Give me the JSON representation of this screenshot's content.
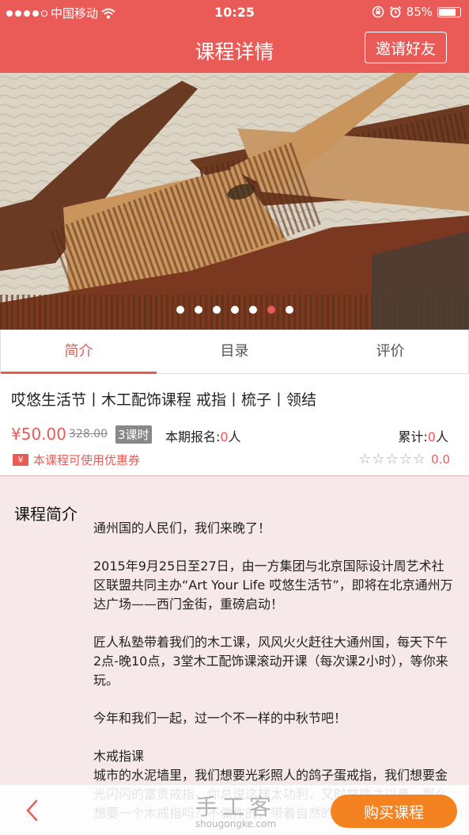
{
  "status": {
    "carrier": "中国移动",
    "time": "10:25",
    "battery_text": "85%",
    "battery_level": 0.85
  },
  "nav": {
    "title": "课程详情",
    "invite_label": "邀请好友"
  },
  "banner": {
    "slide_count": 7,
    "active_index": 5
  },
  "tabs": [
    {
      "label": "简介",
      "active": true
    },
    {
      "label": "目录",
      "active": false
    },
    {
      "label": "评价",
      "active": false
    }
  ],
  "course": {
    "title": "哎悠生活节丨木工配饰课程 戒指丨梳子丨领结",
    "price": "¥50.00",
    "original_price": "328.00",
    "hours": "3课时",
    "enroll_label": "本期报名:",
    "enroll_count": "0",
    "enroll_unit": "人",
    "total_label": "累计:",
    "total_count": "0",
    "total_unit": "人",
    "coupon_icon": "¥",
    "coupon_text": "本课程可使用优惠券",
    "stars": "☆☆☆☆☆",
    "rating": "0.0"
  },
  "intro": {
    "heading": "课程简介",
    "paragraphs": [
      "通州国的人民们，我们来晚了！",
      "2015年9月25日至27日，由一方集团与北京国际设计周艺术社区联盟共同主办“Art Your Life 哎悠生活节”，即将在北京通州万达广场——西门金街，重磅启动！",
      "匠人私塾带着我们的木工课，风风火火赶往大通州国，每天下午2点-晚10点，3堂木工配饰课滚动开课（每次课2小时），等你来玩。",
      "今年和我们一起，过一个不一样的中秋节吧！",
      "木戒指课\n城市的水泥墙里，我们想要光彩照人的鸽子蛋戒指，我们想要金光闪闪的富贵戒指，你总说这样太功利，又时常嗤之以鼻。那么想要一个木戒指吗？不做作的，带着自然的光，也有了一些……"
    ]
  },
  "bottom": {
    "buy_label": "购买课程",
    "watermark_big": "手工客",
    "watermark_small": "shougongke.com"
  },
  "colors": {
    "brand_red": "#ea5a56",
    "buy_orange": "#f58220",
    "intro_bg": "#f7e9e9"
  }
}
